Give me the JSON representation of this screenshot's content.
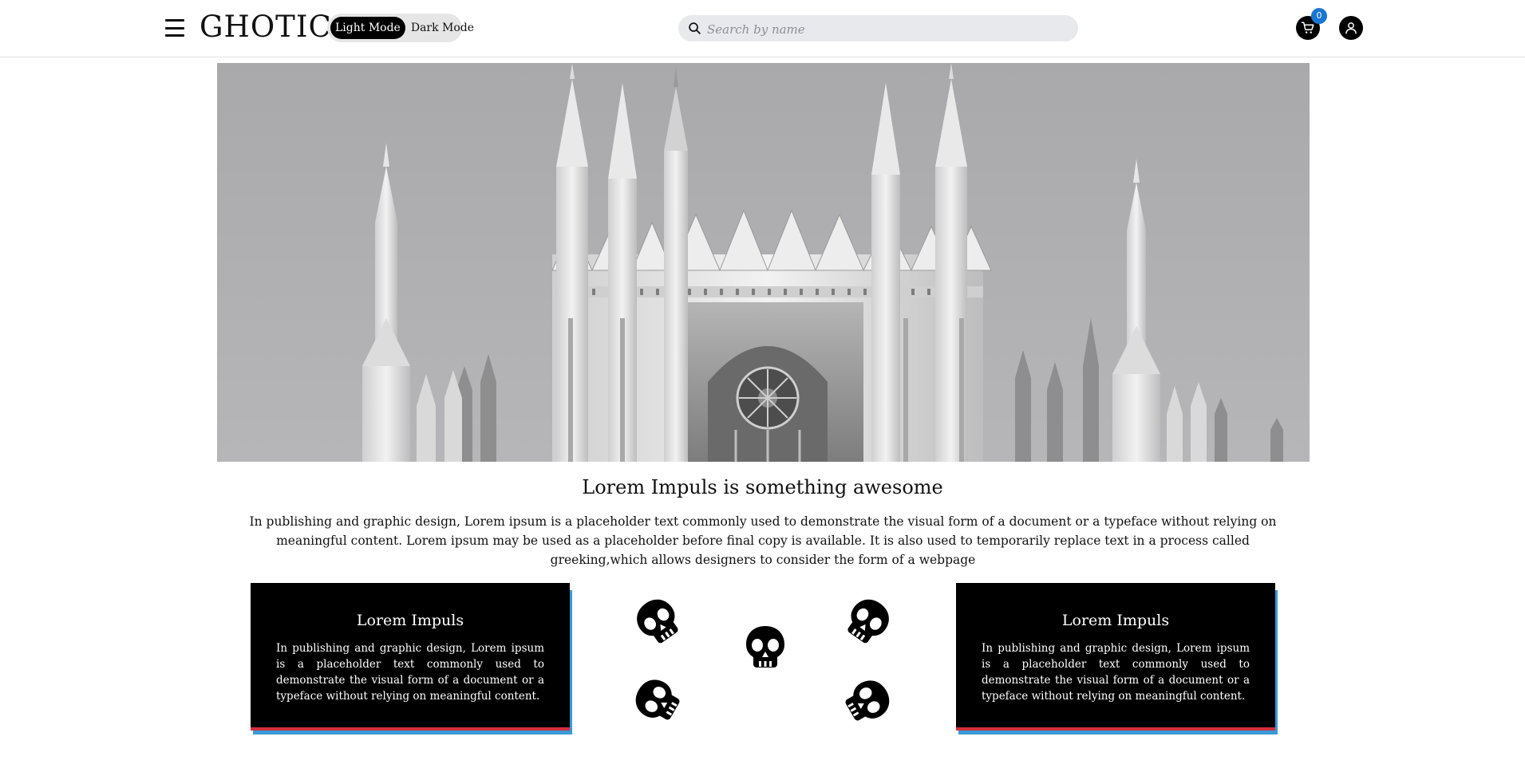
{
  "header": {
    "brand": "GHOTIC",
    "mode_light": "Light Mode",
    "mode_dark": "Dark Mode",
    "search_placeholder": "Search by name",
    "cart_count": "0",
    "icons": [
      "menu-icon",
      "search-icon",
      "cart-icon",
      "user-icon"
    ]
  },
  "hero": {
    "image": "gothic-cathedral"
  },
  "intro": {
    "title": "Lorem Impuls is something awesome",
    "text": "In publishing and graphic design, Lorem ipsum is a placeholder text commonly used to demonstrate the visual form of a document or a typeface without relying on meaningful content. Lorem ipsum may be used as a placeholder before final copy is available. It is also used to temporarily replace text in a process called greeking,which allows designers to consider the form of a webpage"
  },
  "cards": [
    {
      "title": "Lorem Impuls",
      "text": "In publishing and graphic design, Lorem ipsum is a placeholder text commonly used to demonstrate the visual form of a document or a typeface without relying on meaningful content."
    },
    {
      "title": "Lorem Impuls",
      "text": "In publishing and graphic design, Lorem ipsum is a placeholder text commonly used to demonstrate the visual form of a document or a typeface without relying on meaningful content."
    }
  ],
  "colors": {
    "card_bg": "#000000",
    "accent_red": "#d32f3c",
    "accent_blue": "#3a9ad8",
    "badge_blue": "#1976d2"
  },
  "decorations": [
    "skull-icon",
    "skull-icon",
    "skull-icon",
    "skull-icon",
    "skull-icon"
  ]
}
